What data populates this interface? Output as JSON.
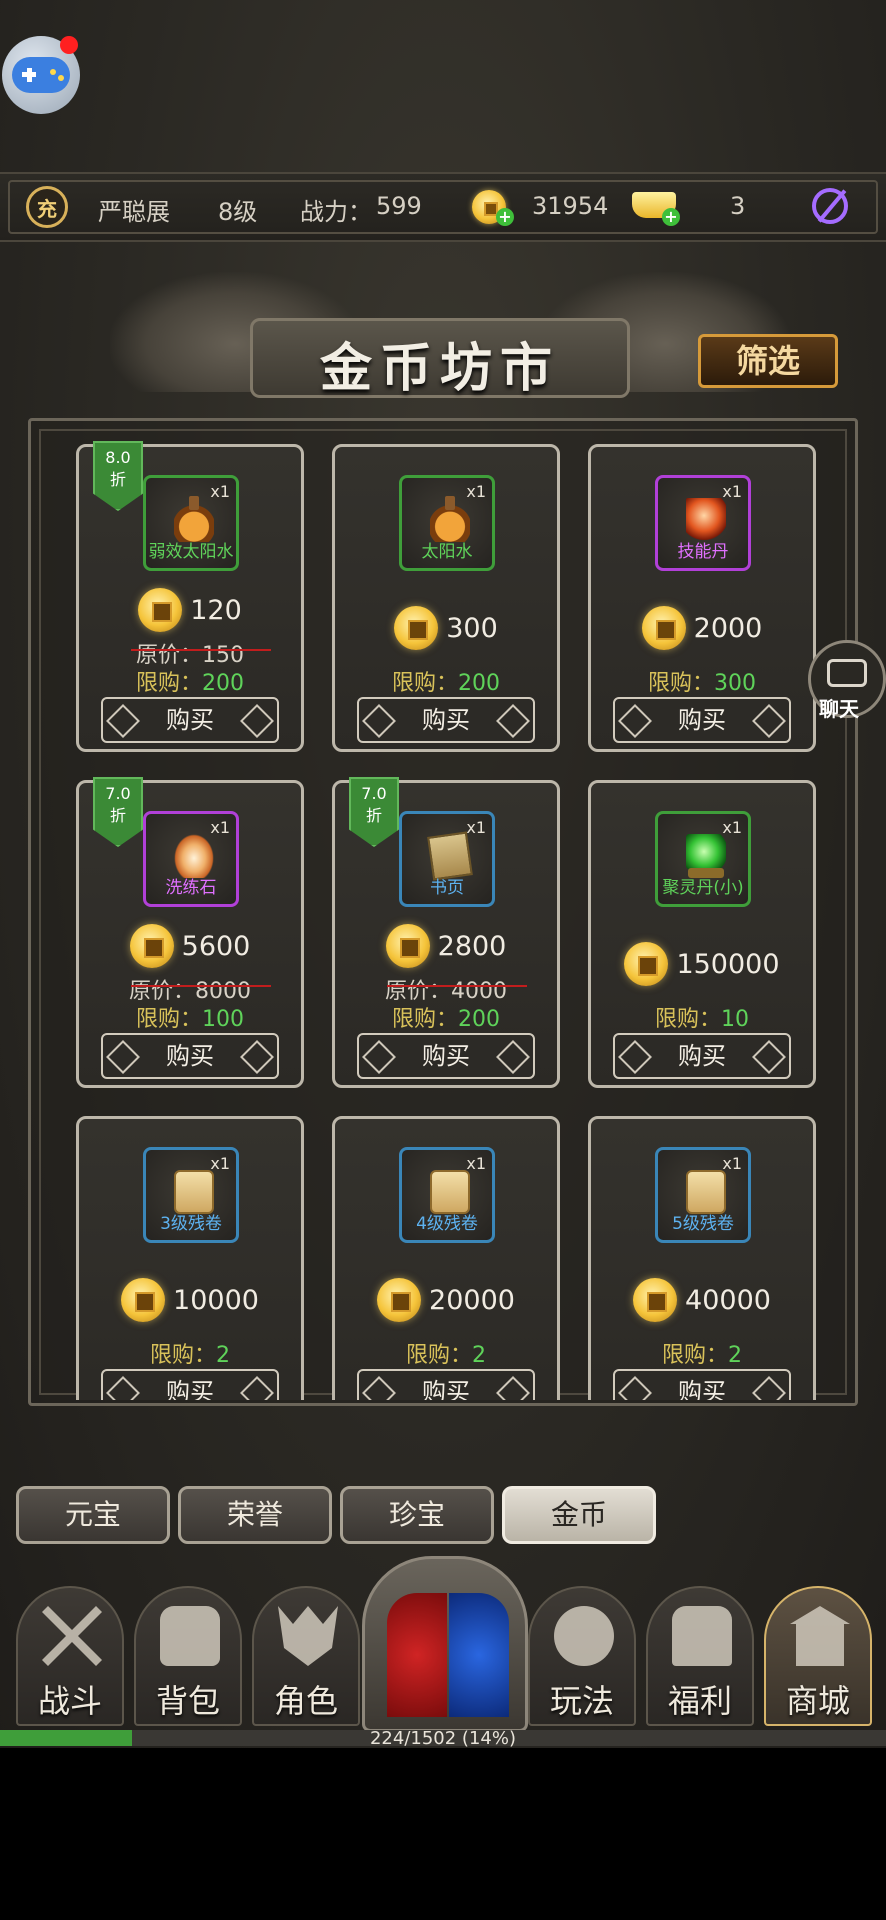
{
  "player": {
    "recharge_label": "充",
    "name": "严聪展",
    "level": "8级",
    "power_label": "战力：",
    "power_value": "599",
    "coins": "31954",
    "ingots": "3"
  },
  "header": {
    "title": "金币坊市",
    "filter_label": "筛选",
    "chat_label": "聊天"
  },
  "items": [
    {
      "name": "弱效太阳水",
      "qty": "x1",
      "rarity": "green",
      "art": "potion",
      "discount": "8.0\n折",
      "price": "120",
      "original_label": "原价：150",
      "limit_key": "限购：",
      "limit_value": "200",
      "buy_label": "购买"
    },
    {
      "name": "太阳水",
      "qty": "x1",
      "rarity": "green",
      "art": "potion",
      "discount": "",
      "price": "300",
      "original_label": "",
      "limit_key": "限购：",
      "limit_value": "200",
      "buy_label": "购买"
    },
    {
      "name": "技能丹",
      "qty": "x1",
      "rarity": "purple",
      "art": "orb",
      "discount": "",
      "price": "2000",
      "original_label": "",
      "limit_key": "限购：",
      "limit_value": "300",
      "buy_label": "购买"
    },
    {
      "name": "洗练石",
      "qty": "x1",
      "rarity": "purple",
      "art": "stone",
      "discount": "7.0\n折",
      "price": "5600",
      "original_label": "原价：8000",
      "limit_key": "限购：",
      "limit_value": "100",
      "buy_label": "购买"
    },
    {
      "name": "书页",
      "qty": "x1",
      "rarity": "blue",
      "art": "pages",
      "discount": "7.0\n折",
      "price": "2800",
      "original_label": "原价：4000",
      "limit_key": "限购：",
      "limit_value": "200",
      "buy_label": "购买"
    },
    {
      "name": "聚灵丹(小)",
      "qty": "x1",
      "rarity": "green",
      "art": "green",
      "discount": "",
      "price": "150000",
      "original_label": "",
      "limit_key": "限购：",
      "limit_value": "10",
      "buy_label": "购买"
    },
    {
      "name": "3级残卷",
      "qty": "x1",
      "rarity": "blue",
      "art": "scroll",
      "discount": "",
      "price": "10000",
      "original_label": "",
      "limit_key": "限购：",
      "limit_value": "2",
      "buy_label": "购买"
    },
    {
      "name": "4级残卷",
      "qty": "x1",
      "rarity": "blue",
      "art": "scroll",
      "discount": "",
      "price": "20000",
      "original_label": "",
      "limit_key": "限购：",
      "limit_value": "2",
      "buy_label": "购买"
    },
    {
      "name": "5级残卷",
      "qty": "x1",
      "rarity": "blue",
      "art": "scroll",
      "discount": "",
      "price": "40000",
      "original_label": "",
      "limit_key": "限购：",
      "limit_value": "2",
      "buy_label": "购买"
    }
  ],
  "tabs": [
    {
      "label": "元宝",
      "active": false
    },
    {
      "label": "荣誉",
      "active": false
    },
    {
      "label": "珍宝",
      "active": false
    },
    {
      "label": "金币",
      "active": true
    }
  ],
  "nav": [
    {
      "label": "战斗",
      "icon": "swords-icon",
      "active": false
    },
    {
      "label": "背包",
      "icon": "backpack-icon",
      "active": false
    },
    {
      "label": "角色",
      "icon": "helmet-icon",
      "active": false
    },
    {
      "label": "玩法",
      "icon": "sword-slash-icon",
      "active": false
    },
    {
      "label": "福利",
      "icon": "treasure-chest-icon",
      "active": false
    },
    {
      "label": "商城",
      "icon": "shop-pavilion-icon",
      "active": true
    }
  ],
  "progress": {
    "label": "224/1502 (14%)",
    "fraction": 0.149
  },
  "colors": {
    "rarity_green": "#3f9e3a",
    "rarity_purple": "#b140d8",
    "rarity_blue": "#3a86b8",
    "limit_value": "#5fd35a",
    "accent_gold": "#d69a3a"
  }
}
